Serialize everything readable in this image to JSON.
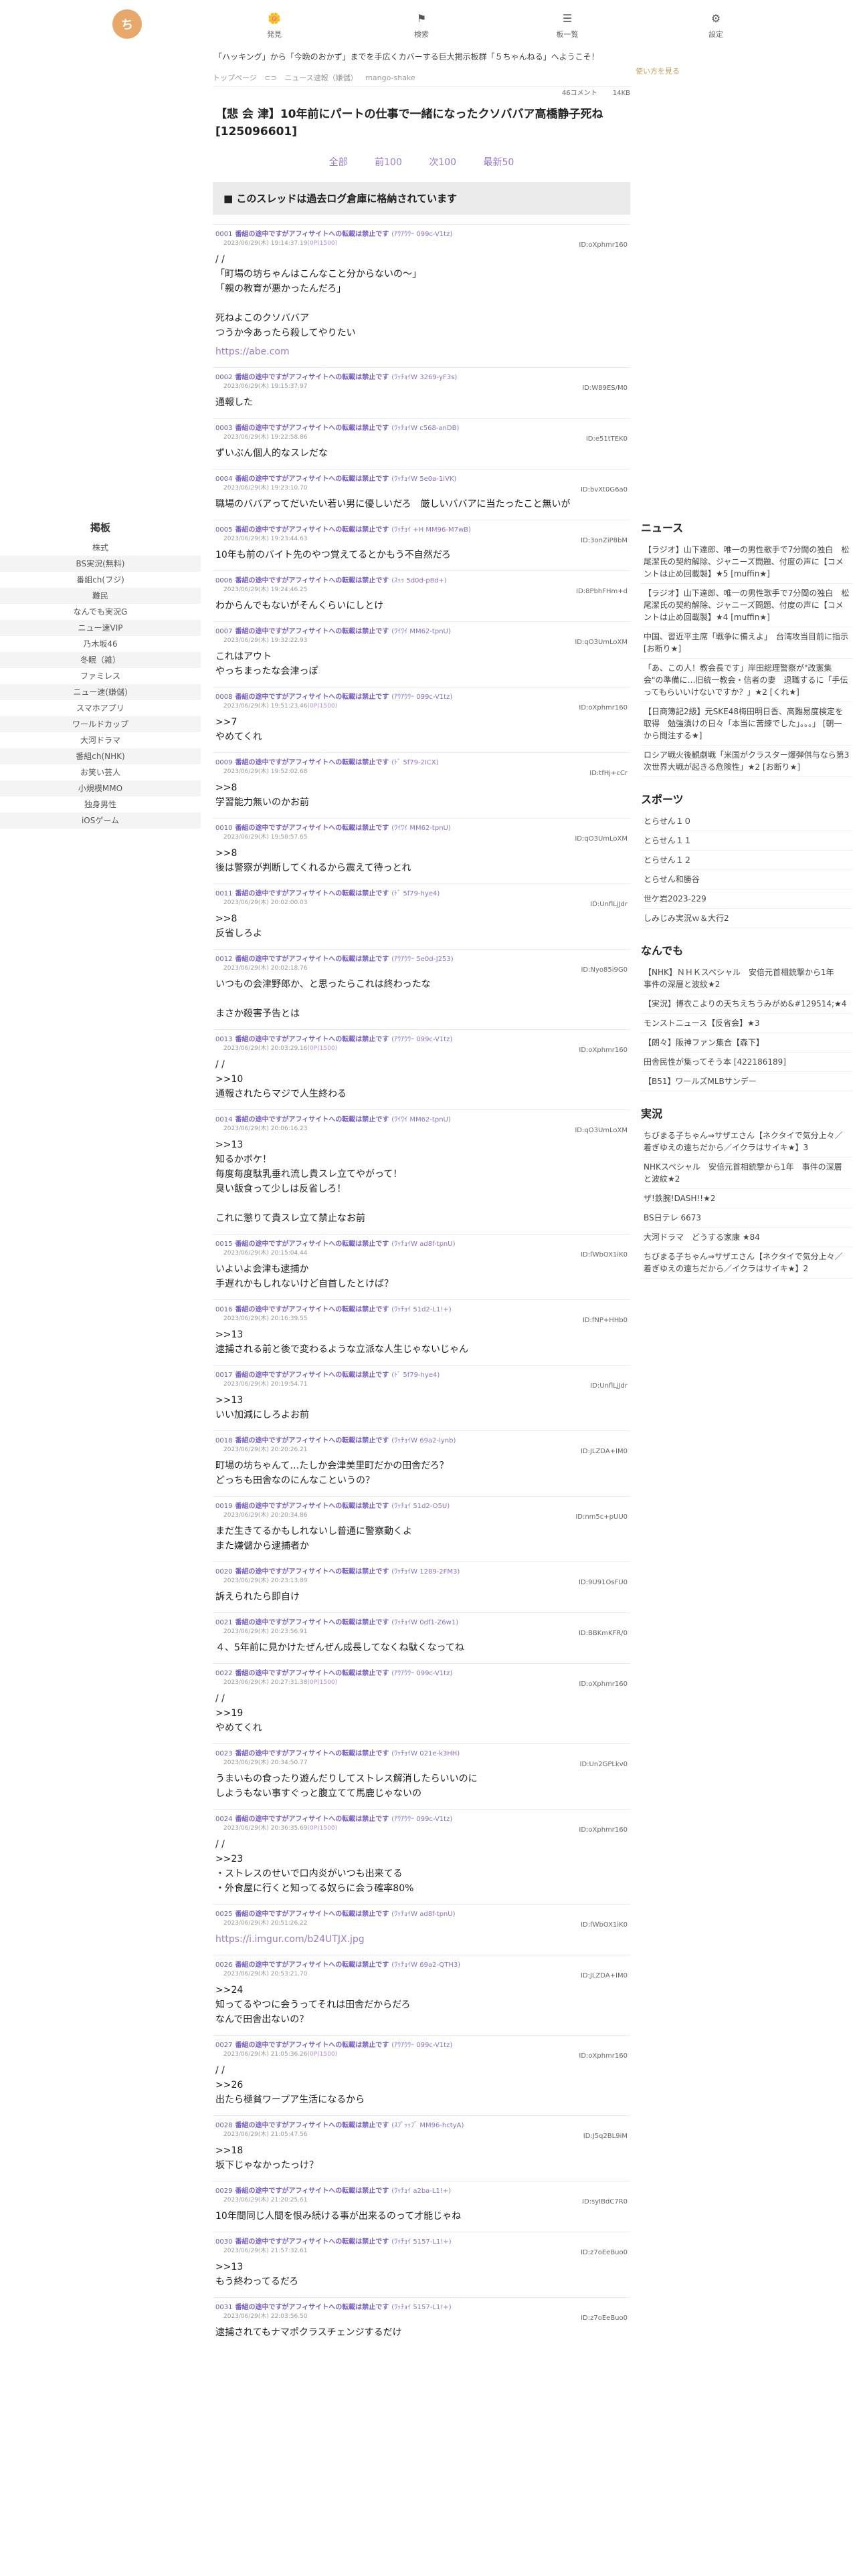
{
  "header": {
    "logo_text": "ち",
    "nav": [
      {
        "icon": "🌼",
        "label": "発見"
      },
      {
        "icon": "⚑",
        "label": "検索"
      },
      {
        "icon": "☰",
        "label": "板一覧"
      },
      {
        "icon": "⚙",
        "label": "設定"
      }
    ],
    "welcome": "「ハッキング」から「今晩のおかず」までを手広くカバーする巨大掲示板群「５ちゃんねる」へようこそ！",
    "welcome_tail": "使い方を見る"
  },
  "left": {
    "heading": "掲板",
    "items": [
      "株式",
      "BS実況(無料)",
      "番組ch(フジ)",
      "難民",
      "なんでも実況G",
      "ニュー速VIP",
      "乃木坂46",
      "冬眠（雑）",
      "ファミレス",
      "ニュー速(嫌儲)",
      "スマホアプリ",
      "ワールドカップ",
      "大河ドラマ",
      "番組ch(NHK)",
      "お笑い芸人",
      "小規模MMO",
      "独身男性",
      "iOSゲーム"
    ]
  },
  "thread": {
    "crumbs": [
      "トップページ",
      "⊂⊃",
      "ニュース速報（嫌儲）",
      "mango-shake"
    ],
    "meta": [
      "46コメント",
      "14KB"
    ],
    "title": "【悲 会 津】10年前にパートの仕事で一緒になったクソババア高橋静子死ね [125096601]",
    "pager": [
      "全部",
      "前100",
      "次100",
      "最新50"
    ],
    "archive": "■ このスレッドは過去ログ倉庫に格納されています"
  },
  "posts": [
    {
      "num": "0001",
      "name": "番組の途中ですがアフィサイトへの転載は禁止です",
      "trip": "(ｱｳｱｳｳｰ 099c-V1tz)",
      "date": "2023/06/29(木) 19:14:37.19",
      "badge": "(0P(1500)",
      "id": "ID:oXphmr160",
      "body": "/ /\n「町場の坊ちゃんはこんなこと分からないの〜」\n「親の教育が悪かったんだろ」\n\n死ねよこのクソババア\nつうか今あったら殺してやりたい",
      "link": "https://abe.com"
    },
    {
      "num": "0002",
      "name": "番組の途中ですがアフィサイトへの転載は禁止です",
      "trip": "(ﾜｯﾁｮｲW 3269-yF3s)",
      "date": "2023/06/29(木) 19:15:37.97",
      "badge": "",
      "id": "ID:W89ES/M0",
      "body": "通報した"
    },
    {
      "num": "0003",
      "name": "番組の途中ですがアフィサイトへの転載は禁止です",
      "trip": "(ﾜｯﾁｮｲW c568-anDB)",
      "date": "2023/06/29(木) 19:22:58.86",
      "badge": "",
      "id": "ID:e51tTEK0",
      "body": "ずいぶん個人的なスレだな"
    },
    {
      "num": "0004",
      "name": "番組の途中ですがアフィサイトへの転載は禁止です",
      "trip": "(ﾜｯﾁｮｲW 5e0a-1iVK)",
      "date": "2023/06/29(木) 19:23:10.70",
      "badge": "",
      "id": "ID:bvXt0G6a0",
      "body": "職場のババアってだいたい若い男に優しいだろ　厳しいババアに当たったこと無いが"
    },
    {
      "num": "0005",
      "name": "番組の途中ですがアフィサイトへの転載は禁止です",
      "trip": "(ﾜｯﾁｮｲ +H MM96-M7wB)",
      "date": "2023/06/29(木) 19:23:44.63",
      "badge": "",
      "id": "ID:3onZiP8bM",
      "body": "10年も前のバイト先のやつ覚えてるとかもう不自然だろ"
    },
    {
      "num": "0006",
      "name": "番組の途中ですがアフィサイトへの転載は禁止です",
      "trip": "(ｽｯｯ 5d0d-p8d+)",
      "date": "2023/06/29(木) 19:24:46.25",
      "badge": "",
      "id": "ID:8PbhFHm+d",
      "body": "わからんでもないがそんくらいにしとけ"
    },
    {
      "num": "0007",
      "name": "番組の途中ですがアフィサイトへの転載は禁止です",
      "trip": "(ﾜｲﾜｲ MM62-tpnU)",
      "date": "2023/06/29(木) 19:32:22.93",
      "badge": "",
      "id": "ID:qO3UmLoXM",
      "body": "これはアウト\nやっちまったな会津っぽ"
    },
    {
      "num": "0008",
      "name": "番組の途中ですがアフィサイトへの転載は禁止です",
      "trip": "(ｱｳｱｳｳｰ 099c-V1tz)",
      "date": "2023/06/29(木) 19:51:23.46",
      "badge": "(0P(1500)",
      "id": "ID:oXphmr160",
      "body": ">>7\nやめてくれ"
    },
    {
      "num": "0009",
      "name": "番組の途中ですがアフィサイトへの転載は禁止です",
      "trip": "(ﾄﾞ 5f79-2ICX)",
      "date": "2023/06/29(木) 19:52:02.68",
      "badge": "",
      "id": "ID:tfHj+cCr",
      "body": ">>8\n学習能力無いのかお前"
    },
    {
      "num": "0010",
      "name": "番組の途中ですがアフィサイトへの転載は禁止です",
      "trip": "(ﾜｲﾜｲ MM62-tpnU)",
      "date": "2023/06/29(木) 19:58:57.65",
      "badge": "",
      "id": "ID:qO3UmLoXM",
      "body": ">>8\n後は警察が判断してくれるから震えて待っとれ"
    },
    {
      "num": "0011",
      "name": "番組の途中ですがアフィサイトへの転載は禁止です",
      "trip": "(ﾄﾞ 5f79-hye4)",
      "date": "2023/06/29(木) 20:02:00.03",
      "badge": "",
      "id": "ID:UnflLjJdr",
      "body": ">>8\n反省しろよ"
    },
    {
      "num": "0012",
      "name": "番組の途中ですがアフィサイトへの転載は禁止です",
      "trip": "(ｱｳｱｳｳｰ 5e0d-J253)",
      "date": "2023/06/29(木) 20:02:18.76",
      "badge": "",
      "id": "ID:Nyo85i9G0",
      "body": "いつもの会津野郎か、と思ったらこれは終わったな\n\nまさか殺害予告とは"
    },
    {
      "num": "0013",
      "name": "番組の途中ですがアフィサイトへの転載は禁止です",
      "trip": "(ｱｳｱｳｳｰ 099c-V1tz)",
      "date": "2023/06/29(木) 20:03:29.16",
      "badge": "(0P(1500)",
      "id": "ID:oXphmr160",
      "body": "/ /\n>>10\n通報されたらマジで人生終わる"
    },
    {
      "num": "0014",
      "name": "番組の途中ですがアフィサイトへの転載は禁止です",
      "trip": "(ﾜｲﾜｲ MM62-tpnU)",
      "date": "2023/06/29(木) 20:06:16.23",
      "badge": "",
      "id": "ID:qO3UmLoXM",
      "body": ">>13\n知るかボケ！\n毎度毎度駄乳垂れ流し貴スレ立てやがって！\n臭い飯食って少しは反省しろ！\n\nこれに懲りて貴スレ立て禁止なお前"
    },
    {
      "num": "0015",
      "name": "番組の途中ですがアフィサイトへの転載は禁止です",
      "trip": "(ﾜｯﾁｮｲW ad8f-tpnU)",
      "date": "2023/06/29(木) 20:15:04.44",
      "badge": "",
      "id": "ID:fWbOX1iK0",
      "body": "いよいよ会津も逮捕か\n手遅れかもしれないけど自首したとけば？"
    },
    {
      "num": "0016",
      "name": "番組の途中ですがアフィサイトへの転載は禁止です",
      "trip": "(ﾜｯﾁｮｲ 51d2-L1!+)",
      "date": "2023/06/29(木) 20:16:39.55",
      "badge": "",
      "id": "ID:fNP+HHb0",
      "body": ">>13\n逮捕される前と後で変わるような立派な人生じゃないじゃん"
    },
    {
      "num": "0017",
      "name": "番組の途中ですがアフィサイトへの転載は禁止です",
      "trip": "(ﾄﾞ 5f79-hye4)",
      "date": "2023/06/29(木) 20:19:54.71",
      "badge": "",
      "id": "ID:UnflLjJdr",
      "body": ">>13\nいい加減にしろよお前"
    },
    {
      "num": "0018",
      "name": "番組の途中ですがアフィサイトへの転載は禁止です",
      "trip": "(ﾜｯﾁｮｲW 69a2-lynb)",
      "date": "2023/06/29(木) 20:20:26.21",
      "badge": "",
      "id": "ID:JLZDA+IM0",
      "body": "町場の坊ちゃんて…たしか会津美里町だかの田舎だろ？\nどっちも田舎なのにんなこというの？"
    },
    {
      "num": "0019",
      "name": "番組の途中ですがアフィサイトへの転載は禁止です",
      "trip": "(ﾜｯﾁｮｲ 51d2-O5U)",
      "date": "2023/06/29(木) 20:20:34.86",
      "badge": "",
      "id": "ID:nm5c+pUU0",
      "body": "まだ生きてるかもしれないし普通に警察動くよ\nまた嫌儲から逮捕者か"
    },
    {
      "num": "0020",
      "name": "番組の途中ですがアフィサイトへの転載は禁止です",
      "trip": "(ﾜｯﾁｮｲW 1289-2FM3)",
      "date": "2023/06/29(木) 20:23:13.89",
      "badge": "",
      "id": "ID:9U91OsFU0",
      "body": "訴えられたら即自け"
    },
    {
      "num": "0021",
      "name": "番組の途中ですがアフィサイトへの転載は禁止です",
      "trip": "(ﾜｯﾁｮｲW 0df1-Z6w1)",
      "date": "2023/06/29(木) 20:23:56.91",
      "badge": "",
      "id": "ID:BBKmKFR/0",
      "body": "４、5年前に見かけたぜんぜん成長してなくね駄くなってね"
    },
    {
      "num": "0022",
      "name": "番組の途中ですがアフィサイトへの転載は禁止です",
      "trip": "(ｱｳｱｳｳｰ 099c-V1tz)",
      "date": "2023/06/29(木) 20:27:31.38",
      "badge": "(0P(1500)",
      "id": "ID:oXphmr160",
      "body": "/ /\n>>19\nやめてくれ"
    },
    {
      "num": "0023",
      "name": "番組の途中ですがアフィサイトへの転載は禁止です",
      "trip": "(ﾜｯﾁｮｲW 021e-k3HH)",
      "date": "2023/06/29(木) 20:34:50.77",
      "badge": "",
      "id": "ID:Un2GPLkv0",
      "body": "うまいもの食ったり遊んだりしてストレス解消したらいいのに\nしようもない事すぐっと腹立てて馬鹿じゃないの"
    },
    {
      "num": "0024",
      "name": "番組の途中ですがアフィサイトへの転載は禁止です",
      "trip": "(ｱｳｱｳｳｰ 099c-V1tz)",
      "date": "2023/06/29(木) 20:36:35.69",
      "badge": "(0P(1500)",
      "id": "ID:oXphmr160",
      "body": "/ /\n>>23\n・ストレスのせいで口内炎がいつも出来てる\n・外食屋に行くと知ってる奴らに会う確率80%"
    },
    {
      "num": "0025",
      "name": "番組の途中ですがアフィサイトへの転載は禁止です",
      "trip": "(ﾜｯﾁｮｲW ad8f-tpnU)",
      "date": "2023/06/29(木) 20:51:26.22",
      "badge": "",
      "id": "ID:fWbOX1iK0",
      "body": "",
      "link": "https://i.imgur.com/b24UTJX.jpg"
    },
    {
      "num": "0026",
      "name": "番組の途中ですがアフィサイトへの転載は禁止です",
      "trip": "(ﾜｯﾁｮｲW 69a2-QTH3)",
      "date": "2023/06/29(木) 20:53:21.70",
      "badge": "",
      "id": "ID:JLZDA+IM0",
      "body": ">>24\n知ってるやつに会うってそれは田舎だからだろ\nなんで田舎出ないの？"
    },
    {
      "num": "0027",
      "name": "番組の途中ですがアフィサイトへの転載は禁止です",
      "trip": "(ｱｳｱｳｳｰ 099c-V1tz)",
      "date": "2023/06/29(木) 21:05:36.26",
      "badge": "(0P(1500)",
      "id": "ID:oXphmr160",
      "body": "/ /\n>>26\n出たら極貧ワープア生活になるから"
    },
    {
      "num": "0028",
      "name": "番組の途中ですがアフィサイトへの転載は禁止です",
      "trip": "(ｽﾌﾟｯｯﾌﾟ MM96-hctyA)",
      "date": "2023/06/29(木) 21:05:47.56",
      "badge": "",
      "id": "ID:J5q2BL9iM",
      "body": ">>18\n坂下じゃなかったっけ？"
    },
    {
      "num": "0029",
      "name": "番組の途中ですがアフィサイトへの転載は禁止です",
      "trip": "(ﾜｯﾁｮｲ a2ba-L1!+)",
      "date": "2023/06/29(木) 21:20:25.61",
      "badge": "",
      "id": "ID:syIBdC7R0",
      "body": "10年間同じ人間を恨み続ける事が出来るのって才能じゃね"
    },
    {
      "num": "0030",
      "name": "番組の途中ですがアフィサイトへの転載は禁止です",
      "trip": "(ﾜｯﾁｮｲ 5157-L1!+)",
      "date": "2023/06/29(木) 21:57:32.61",
      "badge": "",
      "id": "ID:z7oEeBuo0",
      "body": ">>13\nもう終わってるだろ"
    },
    {
      "num": "0031",
      "name": "番組の途中ですがアフィサイトへの転載は禁止です",
      "trip": "(ﾜｯﾁｮｲ 5157-L1!+)",
      "date": "2023/06/29(木) 22:03:56.50",
      "badge": "",
      "id": "ID:z7oEeBuo0",
      "body": "逮捕されてもナマポクラスチェンジするだけ"
    }
  ],
  "right": {
    "sections": [
      {
        "title": "ニュース",
        "items": [
          "【ラジオ】山下達郎、唯一の男性歌手で7分間の独白　松尾潔氏の契約解除、ジャニーズ問題、付度の声に【コメントは止め回載製】★5 [muffin★]",
          "【ラジオ】山下達郎、唯一の男性歌手で7分間の独白　松尾潔氏の契約解除、ジャニーズ問題、付度の声に【コメントは止め回載製】★4 [muffin★]",
          "中国、習近平主席「戦争に備えよ」　台湾攻当目前に指示 [お断り★]",
          "「あ、この人！教会長です」岸田総理警察が\"改憲集会\"の準備に…旧統一教会・信者の妻　退職するに「手伝ってもらいいけないですか？」★2 [くれ★]",
          "【日商簿記2級】元SKE48梅田明日香、高難易度検定を取得　勉強漬けの日々「本当に苦練でした」。。。」 [朝一から閲注する★]",
          "ロシア戦火後観劇戦「米国がクラスター爆弾供与なら第3次世界大戦が起きる危険性」★2 [お断り★]"
        ]
      },
      {
        "title": "スポーツ",
        "items": [
          "とらせん１０",
          "とらせん１１",
          "とらせん１２",
          "とらせん和勝谷",
          "世ケ岩2023-229",
          "しみじみ実況ｗ＆大行2"
        ]
      },
      {
        "title": "なんでも",
        "items": [
          "【NHK】ＮＨＫスペシャル　安倍元首相銃撃から1年　事件の深層と波紋★2",
          "【実況】博衣こよりの天ちえちうみがめ&#129514;★4",
          "モンストニュース【反省会】★3",
          "【朗々】阪神ファン集合【森下】",
          "田舎民性が集ってそう本 [422186189]",
          "【B51】ワールズMLBサンデー"
        ]
      },
      {
        "title": "実況",
        "items": [
          "ちびまる子ちゃん⇒サザエさん【ネクタイで気分上々／着ぎゆえの遠ちだから／イクラはサイキ★】3",
          "NHKスペシャル　安倍元首相銃撃から1年　事件の深層と波紋★2",
          "ザ!鉄腕!DASH!!★2",
          "BS日テレ 6673",
          "大河ドラマ　どうする家康 ★84",
          "ちびまる子ちゃん⇒サザエさん【ネクタイで気分上々／着ぎゆえの遠ちだから／イクラはサイキ★】2"
        ]
      }
    ]
  }
}
